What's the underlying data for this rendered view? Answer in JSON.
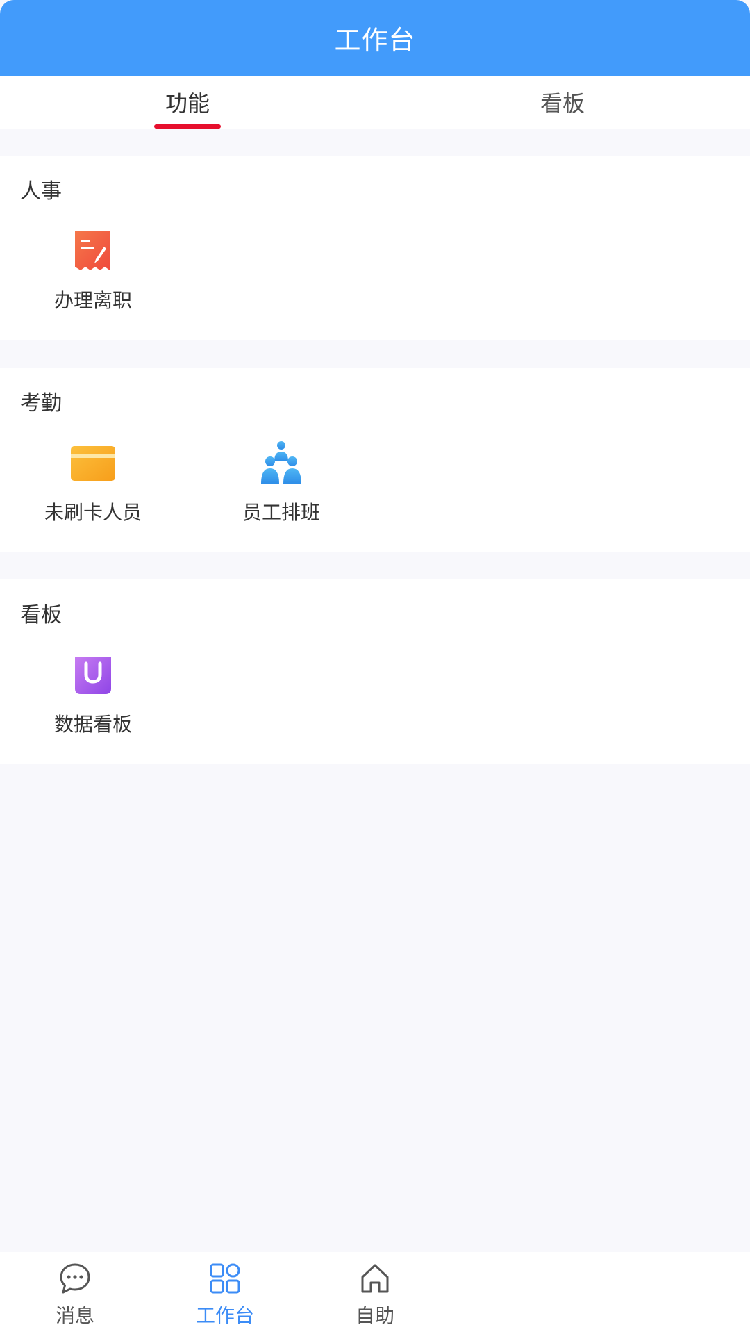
{
  "header": {
    "title": "工作台"
  },
  "tabs": [
    {
      "label": "功能",
      "active": true
    },
    {
      "label": "看板",
      "active": false
    }
  ],
  "sections": [
    {
      "title": "人事",
      "items": [
        {
          "label": "办理离职",
          "icon": "resignation-form-icon"
        }
      ]
    },
    {
      "title": "考勤",
      "items": [
        {
          "label": "未刷卡人员",
          "icon": "card-icon"
        },
        {
          "label": "员工排班",
          "icon": "people-group-icon"
        }
      ]
    },
    {
      "title": "看板",
      "items": [
        {
          "label": "数据看板",
          "icon": "shopping-bag-icon"
        }
      ]
    }
  ],
  "tabbar": {
    "items": [
      {
        "label": "消息",
        "icon": "chat-bubble-icon",
        "active": false
      },
      {
        "label": "工作台",
        "icon": "grid-apps-icon",
        "active": true
      },
      {
        "label": "自助",
        "icon": "home-icon",
        "active": false
      }
    ]
  },
  "colors": {
    "header": "#429bfb",
    "tab_indicator": "#e60f2d",
    "active_nav": "#3c8cf6",
    "background": "#f8f8fc"
  }
}
